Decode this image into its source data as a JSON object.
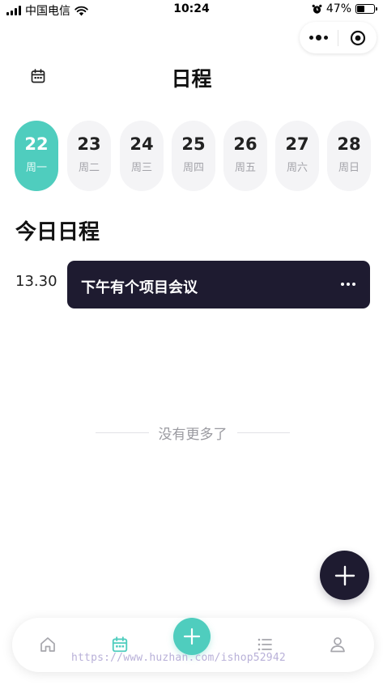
{
  "status_bar": {
    "carrier": "中国电信",
    "time": "10:24",
    "battery_percent": "47%",
    "battery_level": 0.47,
    "icons": [
      "signal-icon",
      "wifi-icon",
      "alarm-icon",
      "battery-icon"
    ]
  },
  "header": {
    "title": "日程",
    "left_icon": "calendar-icon"
  },
  "week": {
    "days": [
      {
        "num": "22",
        "weekday": "周一",
        "active": true
      },
      {
        "num": "23",
        "weekday": "周二",
        "active": false
      },
      {
        "num": "24",
        "weekday": "周三",
        "active": false
      },
      {
        "num": "25",
        "weekday": "周四",
        "active": false
      },
      {
        "num": "26",
        "weekday": "周五",
        "active": false
      },
      {
        "num": "27",
        "weekday": "周六",
        "active": false
      },
      {
        "num": "28",
        "weekday": "周日",
        "active": false
      }
    ]
  },
  "schedule": {
    "section_title": "今日日程",
    "events": [
      {
        "time": "13.30",
        "title": "下午有个项目会议"
      }
    ],
    "end_text": "没有更多了"
  },
  "tabbar": {
    "items": [
      "home-icon",
      "calendar-icon",
      "add-icon",
      "list-icon",
      "user-icon"
    ],
    "active": "calendar-icon"
  },
  "watermark": "https://www.huzhan.com/ishop52942",
  "colors": {
    "accent": "#4fcdbe",
    "dark": "#1e1b30",
    "inactive_day": "#f4f4f6",
    "muted_text": "#9a9aa0"
  }
}
